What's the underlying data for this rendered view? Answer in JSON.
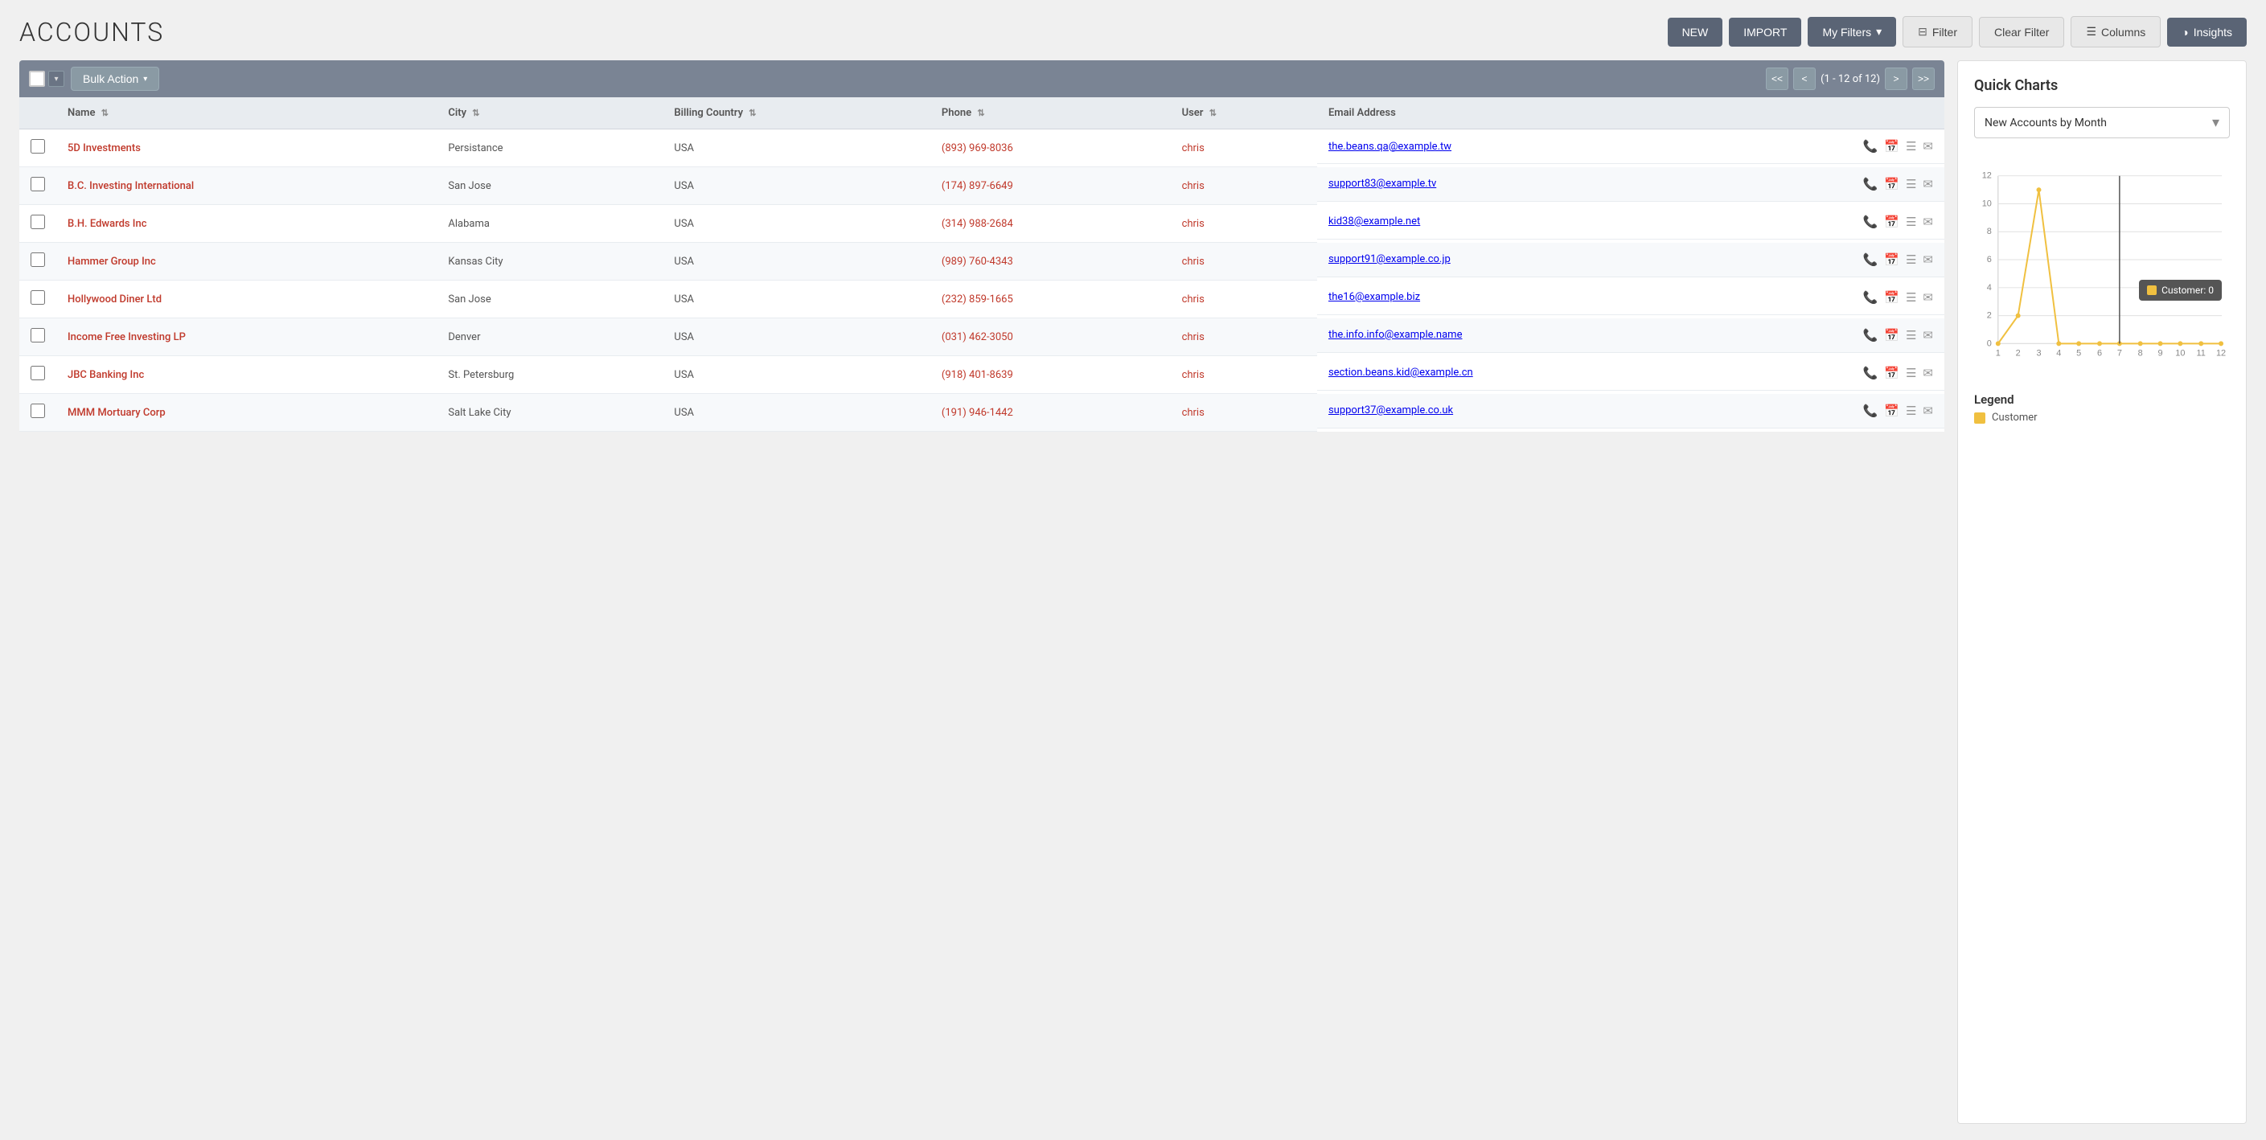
{
  "page": {
    "title": "ACCOUNTS"
  },
  "header_buttons": {
    "new_label": "NEW",
    "import_label": "IMPORT",
    "my_filters_label": "My Filters",
    "filter_label": "Filter",
    "clear_filter_label": "Clear Filter",
    "columns_label": "Columns",
    "insights_label": "Insights"
  },
  "toolbar": {
    "bulk_action_label": "Bulk Action",
    "pagination_text": "(1 - 12 of 12)"
  },
  "table": {
    "columns": [
      {
        "id": "name",
        "label": "Name"
      },
      {
        "id": "city",
        "label": "City"
      },
      {
        "id": "billing_country",
        "label": "Billing Country"
      },
      {
        "id": "phone",
        "label": "Phone"
      },
      {
        "id": "user",
        "label": "User"
      },
      {
        "id": "email_address",
        "label": "Email Address"
      }
    ],
    "rows": [
      {
        "name": "5D Investments",
        "city": "Persistance",
        "billing_country": "USA",
        "phone": "(893) 969-8036",
        "user": "chris",
        "email": "the.beans.qa@example.tw"
      },
      {
        "name": "B.C. Investing International",
        "city": "San Jose",
        "billing_country": "USA",
        "phone": "(174) 897-6649",
        "user": "chris",
        "email": "support83@example.tv"
      },
      {
        "name": "B.H. Edwards Inc",
        "city": "Alabama",
        "billing_country": "USA",
        "phone": "(314) 988-2684",
        "user": "chris",
        "email": "kid38@example.net"
      },
      {
        "name": "Hammer Group Inc",
        "city": "Kansas City",
        "billing_country": "USA",
        "phone": "(989) 760-4343",
        "user": "chris",
        "email": "support91@example.co.jp"
      },
      {
        "name": "Hollywood Diner Ltd",
        "city": "San Jose",
        "billing_country": "USA",
        "phone": "(232) 859-1665",
        "user": "chris",
        "email": "the16@example.biz"
      },
      {
        "name": "Income Free Investing LP",
        "city": "Denver",
        "billing_country": "USA",
        "phone": "(031) 462-3050",
        "user": "chris",
        "email": "the.info.info@example.name"
      },
      {
        "name": "JBC Banking Inc",
        "city": "St. Petersburg",
        "billing_country": "USA",
        "phone": "(918) 401-8639",
        "user": "chris",
        "email": "section.beans.kid@example.cn"
      },
      {
        "name": "MMM Mortuary Corp",
        "city": "Salt Lake City",
        "billing_country": "USA",
        "phone": "(191) 946-1442",
        "user": "chris",
        "email": "support37@example.co.uk"
      }
    ]
  },
  "quick_charts": {
    "title": "Quick Charts",
    "dropdown_label": "New Accounts by Month",
    "tooltip_label": "Customer: 0",
    "legend_title": "Legend",
    "legend_items": [
      {
        "label": "Customer",
        "color": "#f0c040"
      }
    ],
    "chart": {
      "x_labels": [
        "1",
        "2",
        "3",
        "4",
        "5",
        "6",
        "7",
        "8",
        "9",
        "10",
        "11",
        "12"
      ],
      "y_max": 12,
      "data_points": [
        {
          "x": 1,
          "y": 0
        },
        {
          "x": 2,
          "y": 2
        },
        {
          "x": 3,
          "y": 11
        },
        {
          "x": 4,
          "y": 0
        },
        {
          "x": 5,
          "y": 0
        },
        {
          "x": 6,
          "y": 0
        },
        {
          "x": 7,
          "y": 0
        },
        {
          "x": 8,
          "y": 0
        },
        {
          "x": 9,
          "y": 0
        },
        {
          "x": 10,
          "y": 0
        },
        {
          "x": 11,
          "y": 0
        },
        {
          "x": 12,
          "y": 0
        }
      ]
    }
  }
}
